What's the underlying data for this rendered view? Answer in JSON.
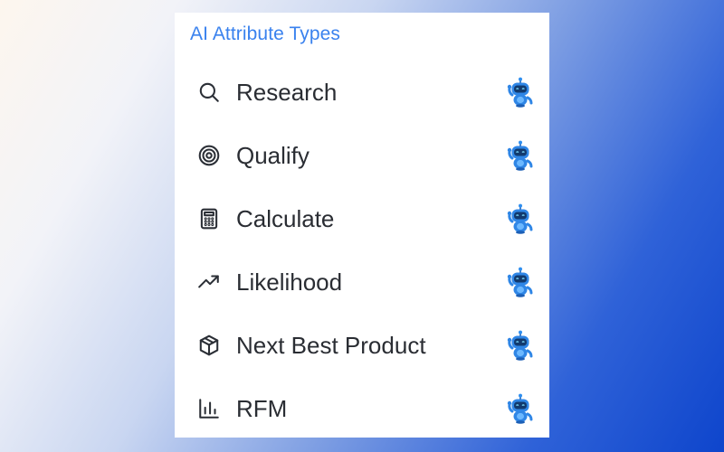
{
  "panel": {
    "title": "AI Attribute Types",
    "title_color": "#3a82ee",
    "items": [
      {
        "label": "Research",
        "icon": "search-icon",
        "badge_icon": "robot-icon"
      },
      {
        "label": "Qualify",
        "icon": "target-icon",
        "badge_icon": "robot-icon"
      },
      {
        "label": "Calculate",
        "icon": "calculator-icon",
        "badge_icon": "robot-icon"
      },
      {
        "label": "Likelihood",
        "icon": "trending-up-icon",
        "badge_icon": "robot-icon"
      },
      {
        "label": "Next Best Product",
        "icon": "package-icon",
        "badge_icon": "robot-icon"
      },
      {
        "label": "RFM",
        "icon": "bar-chart-icon",
        "badge_icon": "robot-icon"
      }
    ]
  }
}
